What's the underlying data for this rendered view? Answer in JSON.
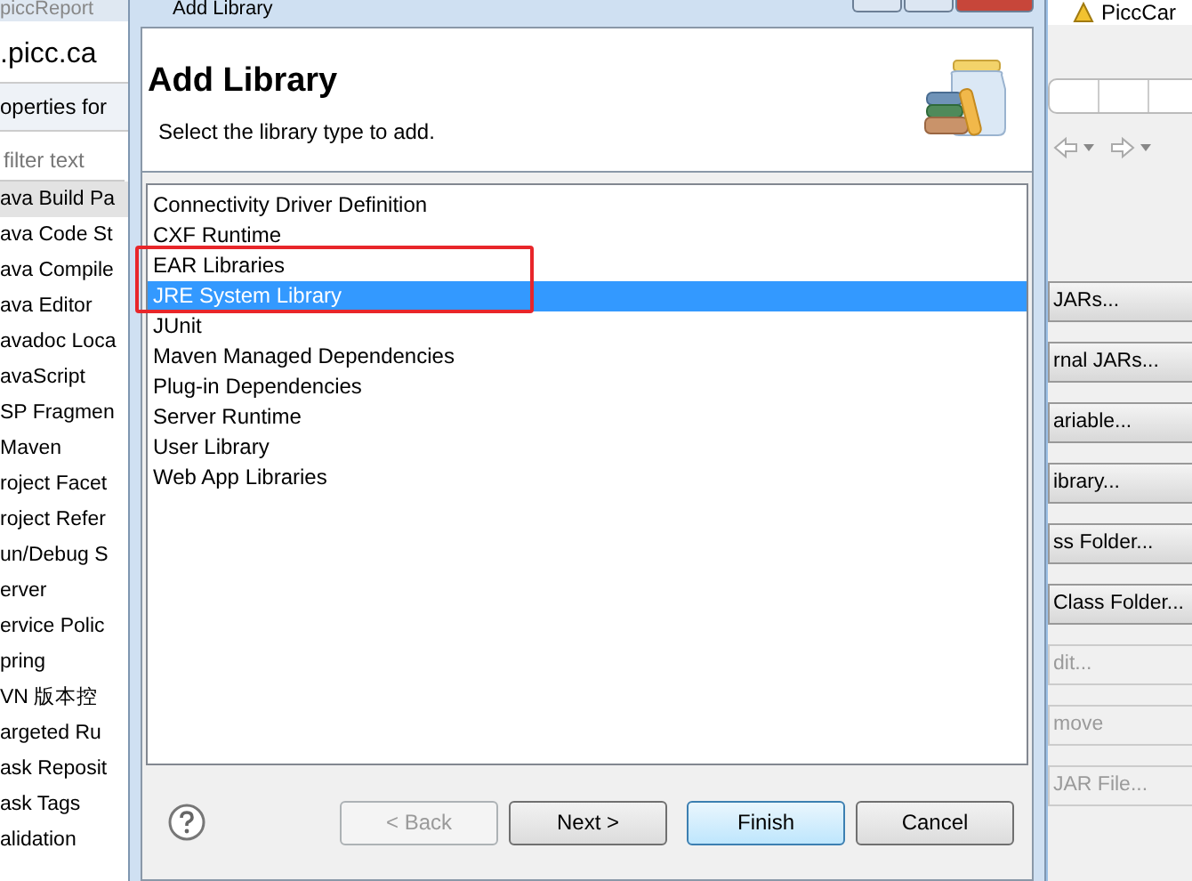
{
  "left_window": {
    "title": "piccReport",
    "project": ".picc.ca",
    "heading": "operties for",
    "filter": {
      "placeholder": "filter text"
    },
    "items": [
      {
        "label": "ava Build Pa",
        "selected": true
      },
      {
        "label": "ava Code St",
        "selected": false
      },
      {
        "label": "ava Compile",
        "selected": false
      },
      {
        "label": "ava Editor",
        "selected": false
      },
      {
        "label": "avadoc Loca",
        "selected": false
      },
      {
        "label": "avaScript",
        "selected": false
      },
      {
        "label": "SP Fragmen",
        "selected": false
      },
      {
        "label": "Maven",
        "selected": false
      },
      {
        "label": "roject Facet",
        "selected": false
      },
      {
        "label": "roject Refer",
        "selected": false
      },
      {
        "label": "un/Debug S",
        "selected": false
      },
      {
        "label": "erver",
        "selected": false
      },
      {
        "label": "ervice Polic",
        "selected": false
      },
      {
        "label": "pring",
        "selected": false
      },
      {
        "label": "VN 版本控",
        "selected": false
      },
      {
        "label": "argeted Ru",
        "selected": false
      },
      {
        "label": "ask Reposit",
        "selected": false
      },
      {
        "label": "ask Tags",
        "selected": false
      },
      {
        "label": "alidation",
        "selected": false
      }
    ]
  },
  "dialog": {
    "title": "Add Library",
    "heading": "Add Library",
    "subtitle": "Select the library type to add.",
    "library_types": [
      {
        "label": "Connectivity Driver Definition",
        "selected": false
      },
      {
        "label": "CXF Runtime",
        "selected": false
      },
      {
        "label": "EAR Libraries",
        "selected": false
      },
      {
        "label": "JRE System Library",
        "selected": true
      },
      {
        "label": "JUnit",
        "selected": false
      },
      {
        "label": "Maven Managed Dependencies",
        "selected": false
      },
      {
        "label": "Plug-in Dependencies",
        "selected": false
      },
      {
        "label": "Server Runtime",
        "selected": false
      },
      {
        "label": "User Library",
        "selected": false
      },
      {
        "label": "Web App Libraries",
        "selected": false
      }
    ],
    "buttons": [
      {
        "label": "< Back",
        "disabled": true,
        "default": false
      },
      {
        "label": "Next >",
        "disabled": false,
        "default": false
      },
      {
        "label": "Finish",
        "disabled": false,
        "default": true
      },
      {
        "label": "Cancel",
        "disabled": false,
        "default": false
      }
    ]
  },
  "right_window": {
    "tab": "PiccCar",
    "buttons": [
      {
        "label": "JARs...",
        "disabled": false
      },
      {
        "label": "rnal JARs...",
        "disabled": false
      },
      {
        "label": "ariable...",
        "disabled": false
      },
      {
        "label": "ibrary...",
        "disabled": false
      },
      {
        "label": "ss Folder...",
        "disabled": false
      },
      {
        "label": "Class Folder...",
        "disabled": false
      },
      {
        "label": "dit...",
        "disabled": true
      },
      {
        "label": "move",
        "disabled": true
      },
      {
        "label": "JAR File...",
        "disabled": true
      }
    ]
  }
}
